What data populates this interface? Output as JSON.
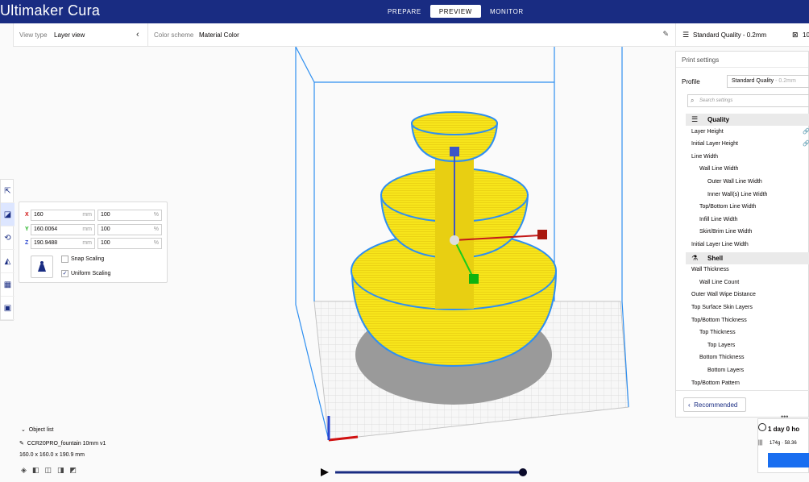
{
  "app": {
    "title": "Ultimaker Cura",
    "tabs": [
      {
        "label": "PREPARE",
        "active": false
      },
      {
        "label": "PREVIEW",
        "active": true
      },
      {
        "label": "MONITOR",
        "active": false
      }
    ]
  },
  "viewbar": {
    "view_type_label": "View type",
    "view_type_value": "Layer view",
    "color_scheme_label": "Color scheme",
    "color_scheme_value": "Material Color"
  },
  "tools": [
    "move-icon",
    "scale-icon",
    "rotate-icon",
    "mirror-icon",
    "per-model-settings-icon",
    "support-blocker-icon"
  ],
  "scale": {
    "x": {
      "label": "X",
      "value": "160",
      "unit": "mm",
      "percent": "100",
      "pct_unit": "%"
    },
    "y": {
      "label": "Y",
      "value": "160.0064",
      "unit": "mm",
      "percent": "100",
      "pct_unit": "%"
    },
    "z": {
      "label": "Z",
      "value": "190.9488",
      "unit": "mm",
      "percent": "100",
      "pct_unit": "%"
    },
    "snap_scaling": "Snap Scaling",
    "uniform_scaling": "Uniform Scaling",
    "snap_checked": false,
    "uniform_checked": true
  },
  "object_list": {
    "header": "Object list",
    "name": "CCR20PRO_fountain 10mm v1",
    "dimensions": "160.0 x 160.0 x 190.9 mm"
  },
  "right_header": {
    "quality": "Standard Quality - 0.2mm",
    "infill": "10"
  },
  "print_settings": {
    "header": "Print settings",
    "profile_label": "Profile",
    "profile_value": "Standard Quality",
    "profile_suffix": "- 0.2mm",
    "search_placeholder": "Search settings",
    "categories": [
      {
        "name": "Quality",
        "icon": "quality-icon"
      },
      {
        "name": "Shell",
        "icon": "shell-icon"
      }
    ],
    "rows": [
      {
        "label": "Layer Height",
        "indent": 0,
        "linked": true
      },
      {
        "label": "Initial Layer Height",
        "indent": 0,
        "linked": true
      },
      {
        "label": "Line Width",
        "indent": 0,
        "linked": false
      },
      {
        "label": "Wall Line Width",
        "indent": 1,
        "linked": false
      },
      {
        "label": "Outer Wall Line Width",
        "indent": 2,
        "linked": false
      },
      {
        "label": "Inner Wall(s) Line Width",
        "indent": 2,
        "linked": false
      },
      {
        "label": "Top/Bottom Line Width",
        "indent": 1,
        "linked": false
      },
      {
        "label": "Infill Line Width",
        "indent": 1,
        "linked": false
      },
      {
        "label": "Skirt/Brim Line Width",
        "indent": 1,
        "linked": false
      },
      {
        "label": "Initial Layer Line Width",
        "indent": 0,
        "linked": false
      },
      {
        "label": "Wall Thickness",
        "indent": 0,
        "linked": false
      },
      {
        "label": "Wall Line Count",
        "indent": 1,
        "linked": false
      },
      {
        "label": "Outer Wall Wipe Distance",
        "indent": 0,
        "linked": false
      },
      {
        "label": "Top Surface Skin Layers",
        "indent": 0,
        "linked": false
      },
      {
        "label": "Top/Bottom Thickness",
        "indent": 0,
        "linked": false
      },
      {
        "label": "Top Thickness",
        "indent": 1,
        "linked": false
      },
      {
        "label": "Top Layers",
        "indent": 2,
        "linked": false
      },
      {
        "label": "Bottom Thickness",
        "indent": 1,
        "linked": false
      },
      {
        "label": "Bottom Layers",
        "indent": 2,
        "linked": false
      },
      {
        "label": "Top/Bottom Pattern",
        "indent": 0,
        "linked": false
      }
    ],
    "recommended_button": "Recommended"
  },
  "estimate": {
    "time": "1 day 0 ho",
    "material": "174g · 58.36"
  },
  "layer_slider": {
    "progress": 1.0
  },
  "colors": {
    "header_bg": "#192c82",
    "accent": "#196ef0",
    "model": "#f7e51b",
    "build_volume_line": "#2f8ff0",
    "shadow": "#9a9a9a"
  }
}
